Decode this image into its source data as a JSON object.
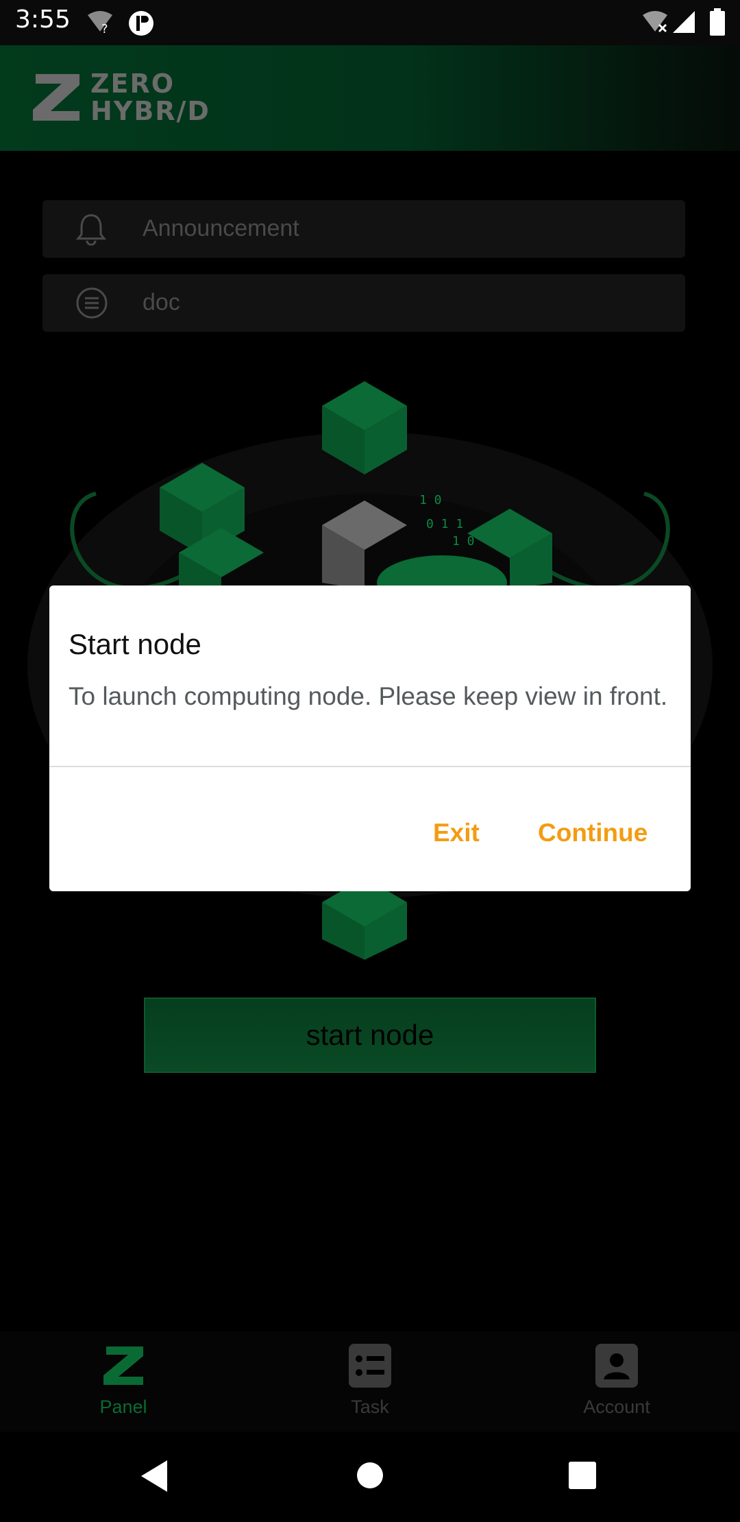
{
  "status_bar": {
    "time": "3:55"
  },
  "app": {
    "logo_line1": "ZERO",
    "logo_line2": "HYBR/D"
  },
  "list": [
    {
      "label": "Announcement",
      "icon": "bell-icon"
    },
    {
      "label": "doc",
      "icon": "document-icon"
    }
  ],
  "main": {
    "start_button": "start node"
  },
  "dialog": {
    "title": "Start node",
    "message": "To launch computing node. Please keep view in front.",
    "exit_label": "Exit",
    "continue_label": "Continue",
    "accent_color": "#f39c12"
  },
  "bottom_nav": [
    {
      "label": "Panel",
      "icon": "panel-logo-icon",
      "active": true
    },
    {
      "label": "Task",
      "icon": "task-list-icon",
      "active": false
    },
    {
      "label": "Account",
      "icon": "account-icon",
      "active": false
    }
  ],
  "colors": {
    "brand": "#0b5a2c",
    "active_nav": "#0a6a34",
    "inactive_nav": "#3a3a3a"
  }
}
